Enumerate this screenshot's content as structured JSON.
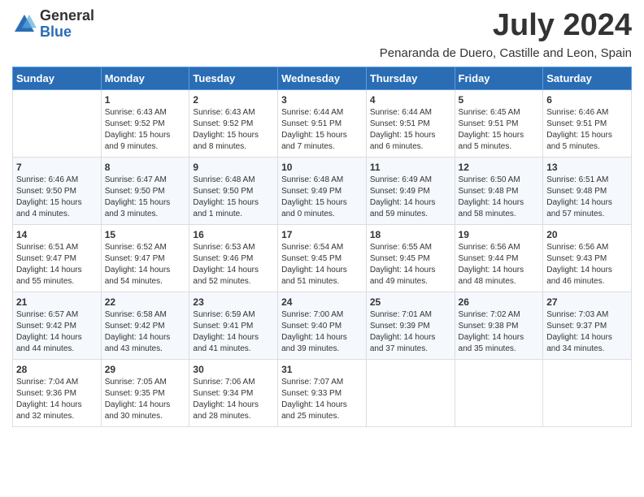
{
  "logo": {
    "general": "General",
    "blue": "Blue"
  },
  "title": "July 2024",
  "subtitle": "Penaranda de Duero, Castille and Leon, Spain",
  "headers": [
    "Sunday",
    "Monday",
    "Tuesday",
    "Wednesday",
    "Thursday",
    "Friday",
    "Saturday"
  ],
  "weeks": [
    [
      {
        "day": "",
        "info": ""
      },
      {
        "day": "1",
        "info": "Sunrise: 6:43 AM\nSunset: 9:52 PM\nDaylight: 15 hours\nand 9 minutes."
      },
      {
        "day": "2",
        "info": "Sunrise: 6:43 AM\nSunset: 9:52 PM\nDaylight: 15 hours\nand 8 minutes."
      },
      {
        "day": "3",
        "info": "Sunrise: 6:44 AM\nSunset: 9:51 PM\nDaylight: 15 hours\nand 7 minutes."
      },
      {
        "day": "4",
        "info": "Sunrise: 6:44 AM\nSunset: 9:51 PM\nDaylight: 15 hours\nand 6 minutes."
      },
      {
        "day": "5",
        "info": "Sunrise: 6:45 AM\nSunset: 9:51 PM\nDaylight: 15 hours\nand 5 minutes."
      },
      {
        "day": "6",
        "info": "Sunrise: 6:46 AM\nSunset: 9:51 PM\nDaylight: 15 hours\nand 5 minutes."
      }
    ],
    [
      {
        "day": "7",
        "info": "Sunrise: 6:46 AM\nSunset: 9:50 PM\nDaylight: 15 hours\nand 4 minutes."
      },
      {
        "day": "8",
        "info": "Sunrise: 6:47 AM\nSunset: 9:50 PM\nDaylight: 15 hours\nand 3 minutes."
      },
      {
        "day": "9",
        "info": "Sunrise: 6:48 AM\nSunset: 9:50 PM\nDaylight: 15 hours\nand 1 minute."
      },
      {
        "day": "10",
        "info": "Sunrise: 6:48 AM\nSunset: 9:49 PM\nDaylight: 15 hours\nand 0 minutes."
      },
      {
        "day": "11",
        "info": "Sunrise: 6:49 AM\nSunset: 9:49 PM\nDaylight: 14 hours\nand 59 minutes."
      },
      {
        "day": "12",
        "info": "Sunrise: 6:50 AM\nSunset: 9:48 PM\nDaylight: 14 hours\nand 58 minutes."
      },
      {
        "day": "13",
        "info": "Sunrise: 6:51 AM\nSunset: 9:48 PM\nDaylight: 14 hours\nand 57 minutes."
      }
    ],
    [
      {
        "day": "14",
        "info": "Sunrise: 6:51 AM\nSunset: 9:47 PM\nDaylight: 14 hours\nand 55 minutes."
      },
      {
        "day": "15",
        "info": "Sunrise: 6:52 AM\nSunset: 9:47 PM\nDaylight: 14 hours\nand 54 minutes."
      },
      {
        "day": "16",
        "info": "Sunrise: 6:53 AM\nSunset: 9:46 PM\nDaylight: 14 hours\nand 52 minutes."
      },
      {
        "day": "17",
        "info": "Sunrise: 6:54 AM\nSunset: 9:45 PM\nDaylight: 14 hours\nand 51 minutes."
      },
      {
        "day": "18",
        "info": "Sunrise: 6:55 AM\nSunset: 9:45 PM\nDaylight: 14 hours\nand 49 minutes."
      },
      {
        "day": "19",
        "info": "Sunrise: 6:56 AM\nSunset: 9:44 PM\nDaylight: 14 hours\nand 48 minutes."
      },
      {
        "day": "20",
        "info": "Sunrise: 6:56 AM\nSunset: 9:43 PM\nDaylight: 14 hours\nand 46 minutes."
      }
    ],
    [
      {
        "day": "21",
        "info": "Sunrise: 6:57 AM\nSunset: 9:42 PM\nDaylight: 14 hours\nand 44 minutes."
      },
      {
        "day": "22",
        "info": "Sunrise: 6:58 AM\nSunset: 9:42 PM\nDaylight: 14 hours\nand 43 minutes."
      },
      {
        "day": "23",
        "info": "Sunrise: 6:59 AM\nSunset: 9:41 PM\nDaylight: 14 hours\nand 41 minutes."
      },
      {
        "day": "24",
        "info": "Sunrise: 7:00 AM\nSunset: 9:40 PM\nDaylight: 14 hours\nand 39 minutes."
      },
      {
        "day": "25",
        "info": "Sunrise: 7:01 AM\nSunset: 9:39 PM\nDaylight: 14 hours\nand 37 minutes."
      },
      {
        "day": "26",
        "info": "Sunrise: 7:02 AM\nSunset: 9:38 PM\nDaylight: 14 hours\nand 35 minutes."
      },
      {
        "day": "27",
        "info": "Sunrise: 7:03 AM\nSunset: 9:37 PM\nDaylight: 14 hours\nand 34 minutes."
      }
    ],
    [
      {
        "day": "28",
        "info": "Sunrise: 7:04 AM\nSunset: 9:36 PM\nDaylight: 14 hours\nand 32 minutes."
      },
      {
        "day": "29",
        "info": "Sunrise: 7:05 AM\nSunset: 9:35 PM\nDaylight: 14 hours\nand 30 minutes."
      },
      {
        "day": "30",
        "info": "Sunrise: 7:06 AM\nSunset: 9:34 PM\nDaylight: 14 hours\nand 28 minutes."
      },
      {
        "day": "31",
        "info": "Sunrise: 7:07 AM\nSunset: 9:33 PM\nDaylight: 14 hours\nand 25 minutes."
      },
      {
        "day": "",
        "info": ""
      },
      {
        "day": "",
        "info": ""
      },
      {
        "day": "",
        "info": ""
      }
    ]
  ]
}
